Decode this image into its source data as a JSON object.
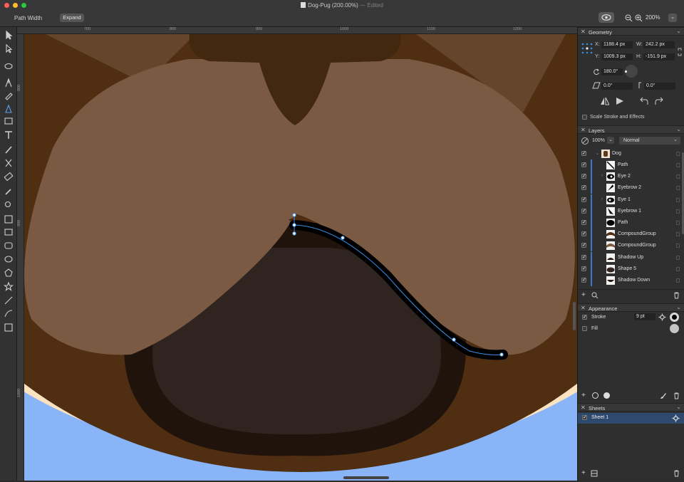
{
  "window": {
    "title": "Dog-Pug (200.00%)",
    "status": "— Edited",
    "traffic_lights": {
      "close": "#fe5f57",
      "minimize": "#febc2e",
      "zoom": "#28c840"
    }
  },
  "context_bar": {
    "tool_name": "Path Width",
    "expand_label": "Expand",
    "zoom": "200%"
  },
  "rulers": {
    "top": [
      "700",
      "800",
      "900",
      "1000",
      "1100",
      "1200"
    ],
    "left": [
      "800",
      "900",
      "1000",
      "1100"
    ]
  },
  "tools": [
    "pointer-tool",
    "direct-select-tool",
    "lasso-tool",
    "pen-tool",
    "pencil-tool",
    "path-width-tool",
    "gradient-tool",
    "text-tool",
    "brush-tool",
    "scissors-tool",
    "eraser-tool",
    "eyedropper-tool",
    "zoom-tool",
    "crop-tool",
    "rectangle-tool",
    "rounded-rectangle-tool",
    "ellipse-tool",
    "polygon-tool",
    "star-tool",
    "line-tool",
    "spiral-tool",
    "artboard-tool"
  ],
  "geometry": {
    "title": "Geometry",
    "x_label": "X:",
    "x_value": "1188.4 px",
    "w_label": "W:",
    "w_value": "242.2 px",
    "y_label": "Y:",
    "y_value": "1009.3 px",
    "h_label": "H:",
    "h_value": "-151.9 px",
    "rotation": "180.0°",
    "skew": "0.0°",
    "corner": "0.0°",
    "scale_stroke_label": "Scale Stroke and Effects"
  },
  "layers": {
    "title": "Layers",
    "opacity": "100%",
    "blend_mode": "Normal",
    "group": "Dog",
    "items": [
      {
        "name": "Path",
        "expandable": false
      },
      {
        "name": "Eye 2",
        "expandable": true
      },
      {
        "name": "Eyebrow 2",
        "expandable": false
      },
      {
        "name": "Eye 1",
        "expandable": true
      },
      {
        "name": "Eyebrow 1",
        "expandable": false
      },
      {
        "name": "Path",
        "expandable": false
      },
      {
        "name": "CompoundGroup",
        "expandable": false
      },
      {
        "name": "CompoundGroup",
        "expandable": false
      },
      {
        "name": "Shadow Up",
        "expandable": false
      },
      {
        "name": "Shape 5",
        "expandable": false
      },
      {
        "name": "Shadow Down",
        "expandable": false
      }
    ]
  },
  "appearance": {
    "title": "Appearance",
    "stroke_label": "Stroke",
    "stroke_width": "9 pt",
    "stroke_color": "#000000",
    "fill_label": "Fill",
    "fill_color": "#c4c4c4"
  },
  "sheets": {
    "title": "Sheets",
    "items": [
      "Sheet 1"
    ]
  },
  "colors": {
    "selection_blue": "#3a8ee6",
    "fur_dark": "#4f2e12",
    "fur_light": "#7a5a43",
    "mouth": "#2f241f",
    "collar_blue": "#8ab4f8",
    "chest_cream": "#fbe3c0"
  }
}
